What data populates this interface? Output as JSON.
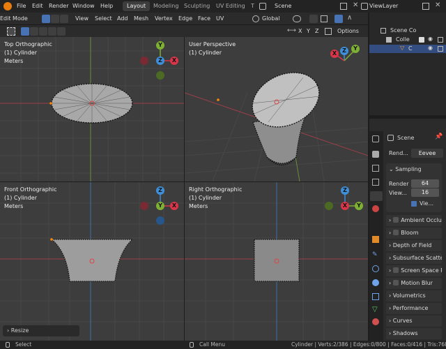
{
  "menubar": {
    "items": [
      "File",
      "Edit",
      "Render",
      "Window",
      "Help"
    ]
  },
  "workspace_tabs": [
    "Layout",
    "Modeling",
    "Sculpting",
    "UV Editing",
    "T"
  ],
  "scene_name": "Scene",
  "view_layer": "ViewLayer",
  "viewport_header": {
    "mode": "Edit Mode",
    "menus": [
      "View",
      "Select",
      "Add",
      "Mesh",
      "Vertex",
      "Edge",
      "Face",
      "UV"
    ],
    "transform": "Global",
    "axes": [
      "X",
      "Y",
      "Z"
    ],
    "options": "Options"
  },
  "viewports": [
    {
      "title": "Top Orthographic",
      "object": "(1) Cylinder",
      "units": "Meters"
    },
    {
      "title": "User Perspective",
      "object": "(1) Cylinder",
      "units": ""
    },
    {
      "title": "Front Orthographic",
      "object": "(1) Cylinder",
      "units": "Meters"
    },
    {
      "title": "Right Orthographic",
      "object": "(1) Cylinder",
      "units": "Meters"
    }
  ],
  "gizmo_labels": {
    "x": "X",
    "y": "Y",
    "z": "Z"
  },
  "outliner": {
    "rows": [
      "Scene Co",
      "Colle",
      "C"
    ]
  },
  "properties": {
    "scene": "Scene",
    "render_label": "Rend...",
    "engine": "Eevee",
    "sampling": "Sampling",
    "render_samples_label": "Render",
    "render_samples": "64",
    "viewport_samples_label": "View...",
    "viewport_samples": "16",
    "denoise_label": "Vie...",
    "panels": [
      "Ambient Occlus",
      "Bloom",
      "Depth of Field",
      "Subsurface Scatter",
      "Screen Space R",
      "Motion Blur",
      "Volumetrics",
      "Performance",
      "Curves",
      "Shadows"
    ]
  },
  "last_op": "Resize",
  "status": {
    "left": "Select",
    "center": "Call Menu",
    "right": "Cylinder | Verts:2/386 | Edges:0/800 | Faces:0/416 | Tris:768 |"
  },
  "colors": {
    "x": "#d9364a",
    "y": "#7eb033",
    "z": "#3f8fd8",
    "accent": "#4772b3"
  }
}
